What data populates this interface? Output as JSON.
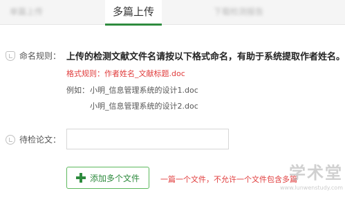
{
  "tabs": [
    {
      "label": "单篇上传",
      "state": "blurred"
    },
    {
      "label": "多篇上传",
      "state": "active"
    },
    {
      "label": "下载检测报告",
      "state": "blurred"
    }
  ],
  "naming_rule": {
    "label": "命名规则：",
    "main_text": "上传的检测文献文件名请按以下格式命名，有助于系统提取作者姓名。",
    "format_text": "格式规则：作者姓名_文献标题.doc",
    "example_prefix": "例如：",
    "examples": [
      "小明_信息管理系统的设计1.doc",
      "小明_信息管理系统的设计2.doc"
    ]
  },
  "pending": {
    "label": "待检论文：",
    "value": ""
  },
  "add_button": {
    "label": "添加多个文件",
    "icon": "plus-icon"
  },
  "upload_note": "一篇一个文件，不允许一个文件包含多篇",
  "watermark": {
    "logo": "学术堂",
    "url": "www.lunwenstudy.com"
  },
  "colors": {
    "accent_green": "#2e8b3e",
    "warning_red": "#e03c3c",
    "tab_background": "#f5f5f5"
  }
}
